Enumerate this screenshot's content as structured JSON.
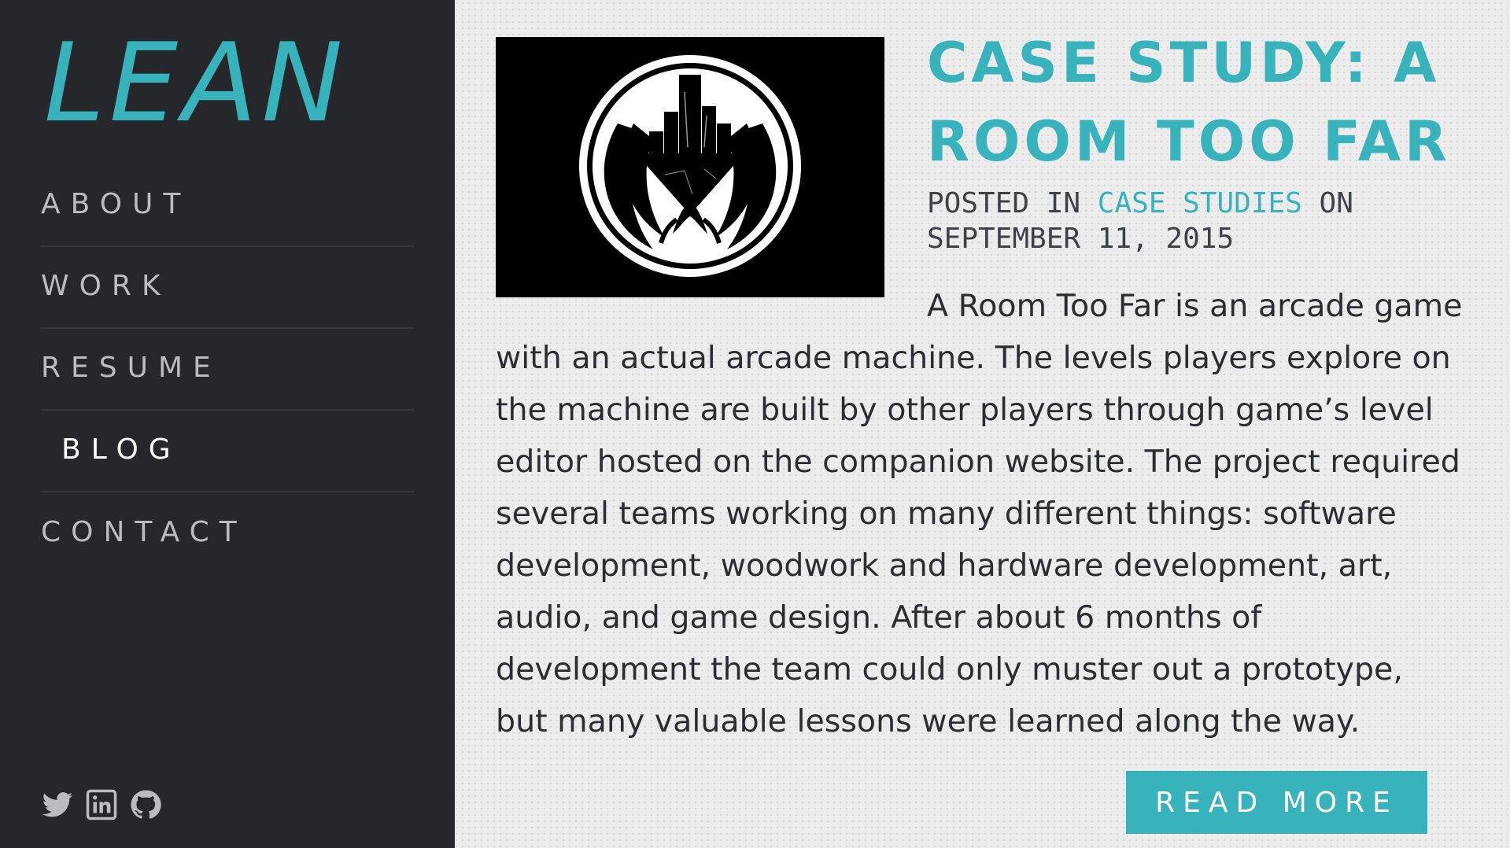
{
  "site": {
    "logo": "LEAN",
    "accent_color": "#38b2bb",
    "sidebar_bg": "#25272b"
  },
  "nav": {
    "items": [
      {
        "label": "ABOUT",
        "active": false
      },
      {
        "label": "WORK",
        "active": false
      },
      {
        "label": "RESUME",
        "active": false
      },
      {
        "label": "BLOG",
        "active": true
      },
      {
        "label": "CONTACT",
        "active": false
      }
    ]
  },
  "social": [
    "twitter-icon",
    "linkedin-icon",
    "github-icon"
  ],
  "post": {
    "title": "CASE STUDY: A ROOM TOO FAR",
    "meta_prefix": "POSTED IN",
    "category": "CASE STUDIES",
    "meta_on": "ON",
    "date": "SEPTEMBER 11, 2015",
    "excerpt": "A Room Too Far is an arcade game with an actual arcade machine. The levels players explore on the machine are built by other players through game’s level editor hosted on the companion website. The project required several teams working on many different things: software development, woodwork and hardware development, art, audio, and game design. After about 6 months of development the team could only muster out a prototype, but many valuable lessons were learned along the way.",
    "read_more": "READ MORE"
  }
}
